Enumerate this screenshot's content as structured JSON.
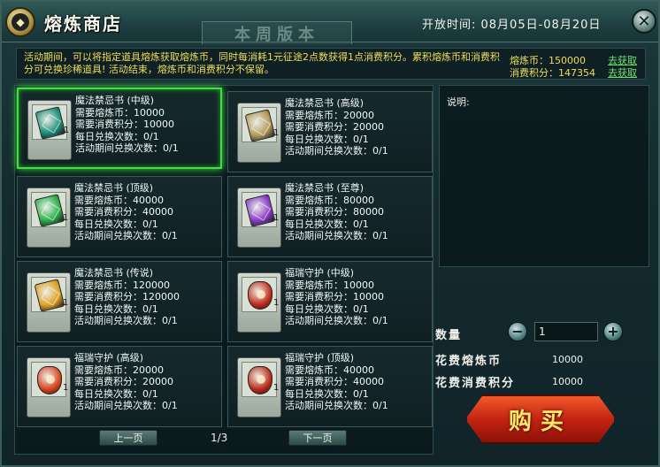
{
  "title": "熔炼商店",
  "deco_plaque": "本周版本",
  "open_time": "开放时间: 08月05日-08月20日",
  "notice": "活动期间，可以将指定道具熔炼获取熔炼币，同时每消耗1元征途2点数获得1点消费积分。累积熔炼币和消费积分可兑换珍稀道具! 活动结束，熔炼币和消费积分不保留。",
  "currency": [
    {
      "label": "熔炼币：",
      "value": "150000",
      "link": "去获取"
    },
    {
      "label": "消费积分：",
      "value": "147354",
      "link": "去获取"
    }
  ],
  "items": [
    {
      "name": "魔法禁忌书 (中级)",
      "cost_coin": "需要熔炼币：10000",
      "cost_points": "需要消费积分：10000",
      "daily": "每日兑换次数：0/1",
      "event": "活动期间兑换次数：0/1",
      "count": "1",
      "kind": "book",
      "color": "#1f8f7a"
    },
    {
      "name": "魔法禁忌书 (高级)",
      "cost_coin": "需要熔炼币：20000",
      "cost_points": "需要消费积分：20000",
      "daily": "每日兑换次数：0/1",
      "event": "活动期间兑换次数：0/1",
      "count": "1",
      "kind": "book",
      "color": "#b49a5a"
    },
    {
      "name": "魔法禁忌书 (顶级)",
      "cost_coin": "需要熔炼币：40000",
      "cost_points": "需要消费积分：40000",
      "daily": "每日兑换次数：0/1",
      "event": "活动期间兑换次数：0/1",
      "count": "1",
      "kind": "book",
      "color": "#2bb04a"
    },
    {
      "name": "魔法禁忌书 (至尊)",
      "cost_coin": "需要熔炼币：80000",
      "cost_points": "需要消费积分：80000",
      "daily": "每日兑换次数：0/1",
      "event": "活动期间兑换次数：0/1",
      "count": "1",
      "kind": "book",
      "color": "#8a3cc8"
    },
    {
      "name": "魔法禁忌书 (传说)",
      "cost_coin": "需要熔炼币：120000",
      "cost_points": "需要消费积分：120000",
      "daily": "每日兑换次数：0/1",
      "event": "活动期间兑换次数：0/1",
      "count": "1",
      "kind": "book",
      "color": "#e0a020"
    },
    {
      "name": "福瑞守护 (中级)",
      "cost_coin": "需要熔炼币：10000",
      "cost_points": "需要消费积分：10000",
      "daily": "每日兑换次数：0/1",
      "event": "活动期间兑换次数：0/1",
      "count": "1",
      "kind": "gem",
      "color": "#c02a1a"
    },
    {
      "name": "福瑞守护 (高级)",
      "cost_coin": "需要熔炼币：20000",
      "cost_points": "需要消费积分：20000",
      "daily": "每日兑换次数：0/1",
      "event": "活动期间兑换次数：0/1",
      "count": "1",
      "kind": "gem",
      "color": "#d8401c"
    },
    {
      "name": "福瑞守护 (顶级)",
      "cost_coin": "需要熔炼币：40000",
      "cost_points": "需要消费积分：40000",
      "daily": "每日兑换次数：0/1",
      "event": "活动期间兑换次数：0/1",
      "count": "1",
      "kind": "gem",
      "color": "#b82818"
    }
  ],
  "pager": {
    "prev": "上一页",
    "page": "1/3",
    "next": "下一页"
  },
  "desc_label": "说明:",
  "qty": {
    "label": "数量",
    "minus": "−",
    "plus": "+",
    "value": "1"
  },
  "costs": [
    {
      "label": "花费熔炼币",
      "value": "10000"
    },
    {
      "label": "花费消费积分",
      "value": "10000"
    }
  ],
  "buy_label": "购买"
}
